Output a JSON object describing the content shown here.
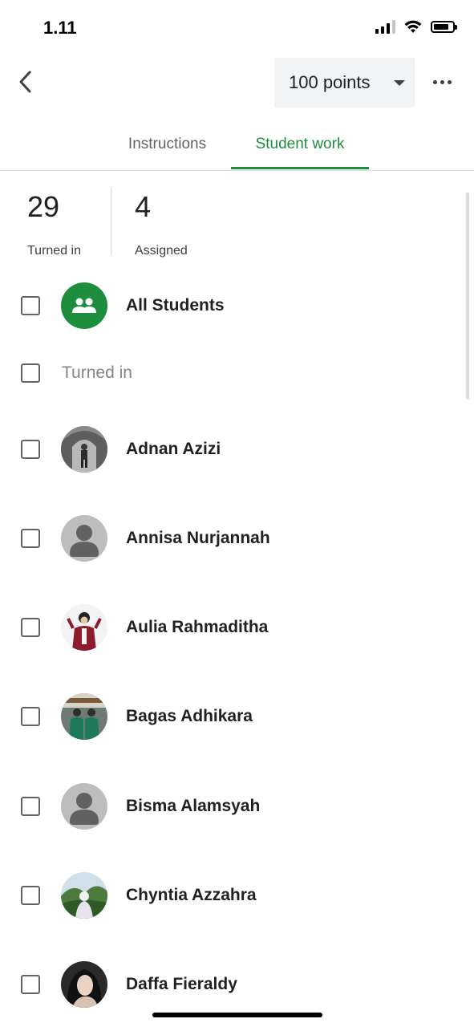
{
  "status_bar": {
    "time": "1.11",
    "icons": [
      "signal-icon",
      "wifi-icon",
      "battery-icon"
    ]
  },
  "app_bar": {
    "back_icon": "chevron-left-icon",
    "points_label": "100 points",
    "dropdown_icon": "caret-down-icon",
    "more_icon": "more-horizontal-icon"
  },
  "tabs": [
    {
      "label": "Instructions",
      "selected": false
    },
    {
      "label": "Student work",
      "selected": true
    }
  ],
  "stats": {
    "turned_in": {
      "count": "29",
      "label": "Turned in"
    },
    "assigned": {
      "count": "4",
      "label": "Assigned"
    }
  },
  "all_students": {
    "label": "All Students",
    "icon": "group-icon"
  },
  "section": {
    "label": "Turned in"
  },
  "students": [
    {
      "name": "Adnan Azizi",
      "avatar": "photo"
    },
    {
      "name": "Annisa Nurjannah",
      "avatar": "default"
    },
    {
      "name": "Aulia Rahmaditha",
      "avatar": "photo"
    },
    {
      "name": "Bagas Adhikara",
      "avatar": "photo"
    },
    {
      "name": "Bisma Alamsyah",
      "avatar": "default"
    },
    {
      "name": "Chyntia Azzahra",
      "avatar": "photo"
    },
    {
      "name": "Daffa Fieraldy",
      "avatar": "photo"
    }
  ],
  "colors": {
    "accent_green": "#1e8e3e",
    "text_primary": "#202124",
    "text_secondary": "#5f6368",
    "divider": "#dadce0",
    "avatar_default_bg": "#bdbdbd"
  }
}
